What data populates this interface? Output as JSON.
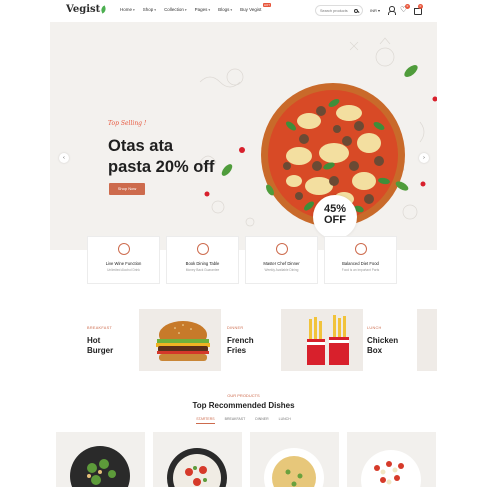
{
  "header": {
    "logo": "Vegist",
    "nav": [
      {
        "label": "Home",
        "has_dropdown": true
      },
      {
        "label": "Shop",
        "has_dropdown": true
      },
      {
        "label": "Collection",
        "has_dropdown": true
      },
      {
        "label": "Pages",
        "has_dropdown": true
      },
      {
        "label": "Blogs",
        "has_dropdown": true
      },
      {
        "label": "Buy Vegist",
        "has_dropdown": false,
        "badge": "HOT"
      }
    ],
    "search": {
      "placeholder": "Search products"
    },
    "language": "INR",
    "wishlist_count": "0",
    "cart_count": "0"
  },
  "hero": {
    "tag": "Top Selling !",
    "title_line1": "Otas ata",
    "title_line2": "pasta 20% off",
    "button": "Shop Now",
    "discount_pct": "45%",
    "discount_off": "OFF",
    "arrow_left": "‹",
    "arrow_right": "›"
  },
  "features": [
    {
      "title": "Live Wine Function",
      "subtitle": "Unlimited Alcohol Drink",
      "icon": "wine-icon"
    },
    {
      "title": "Book Dining Table",
      "subtitle": "Money Back Guarantee",
      "icon": "dining-table-icon"
    },
    {
      "title": "Master Chef Dinner",
      "subtitle": "Weekly Available Dining",
      "icon": "chef-hat-icon"
    },
    {
      "title": "Balanced Diet Food",
      "subtitle": "Food is an important Parts",
      "icon": "plate-icon"
    }
  ],
  "categories": [
    {
      "label": "BREAKFAST",
      "title1": "Hot",
      "title2": "Burger"
    },
    {
      "label": "DINNER",
      "title1": "French",
      "title2": "Fries"
    },
    {
      "label": "LUNCH",
      "title1": "Chicken",
      "title2": "Box"
    }
  ],
  "products_section": {
    "sub_label": "OUR PRODUCTS",
    "title": "Top Recommended Dishes",
    "tabs": [
      "STARTERS",
      "BREAKFAST",
      "DINNER",
      "LUNCH"
    ]
  },
  "colors": {
    "accent": "#cd6b4d",
    "hero_bg": "#f3f1ee",
    "badge": "#e7553b"
  }
}
